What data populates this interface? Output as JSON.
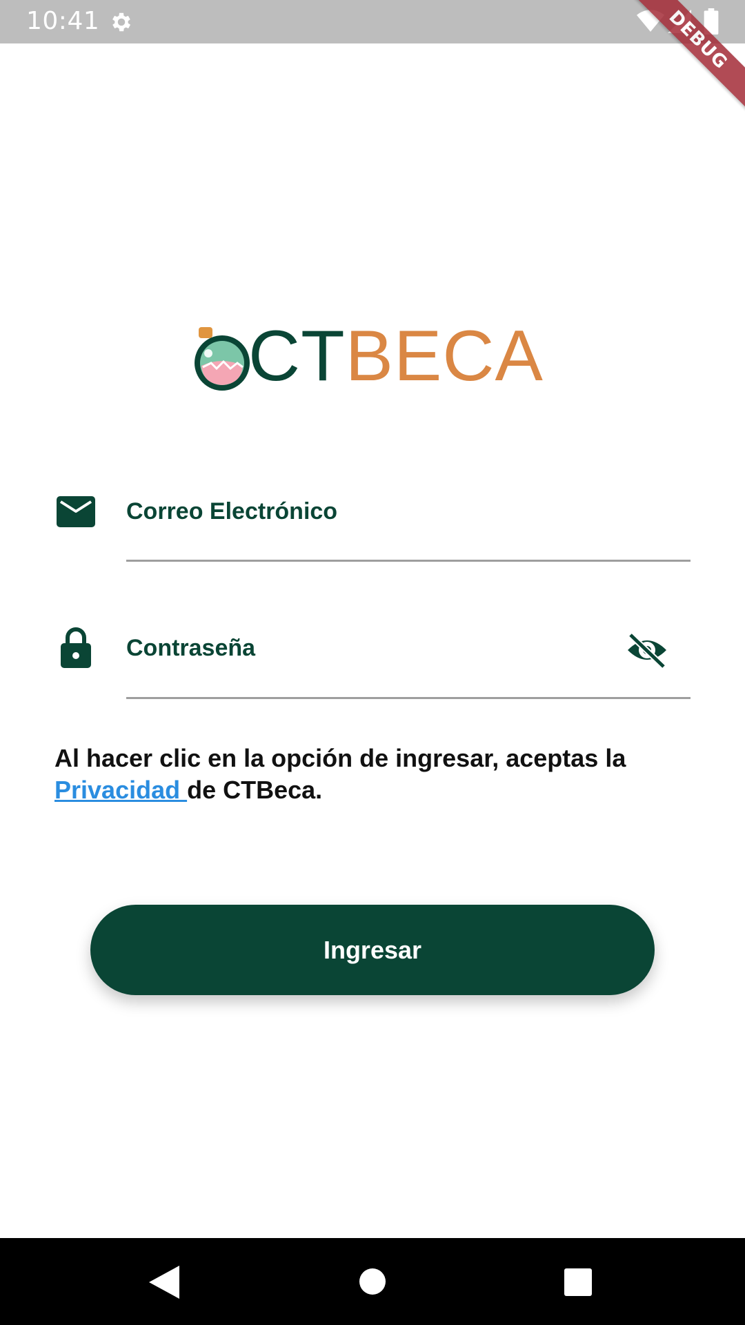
{
  "status_bar": {
    "time": "10:41",
    "icons": [
      "gear-icon",
      "wifi-icon",
      "signal-icon",
      "battery-icon"
    ]
  },
  "debug_banner": "DEBUG",
  "logo": {
    "part1": "CT",
    "part2": "BECA",
    "colors": {
      "primary": "#0a4535",
      "accent": "#da8744"
    }
  },
  "form": {
    "email": {
      "label": "Correo Electrónico",
      "value": "",
      "icon": "envelope-icon"
    },
    "password": {
      "label": "Contraseña",
      "value": "",
      "icon": "lock-icon",
      "toggle_icon": "visibility-off-icon"
    }
  },
  "terms": {
    "prefix": "Al hacer clic en la opción de ingresar, aceptas la ",
    "link_text": "Privacidad ",
    "suffix": "de CTBeca."
  },
  "login_button": {
    "label": "Ingresar"
  },
  "nav_bar": {
    "icons": [
      "back-icon",
      "home-icon",
      "recents-icon"
    ]
  },
  "colors": {
    "brand_green": "#0a4535",
    "brand_orange": "#da8744",
    "link_blue": "#2a8de0",
    "status_bar_bg": "#bdbdbd"
  }
}
